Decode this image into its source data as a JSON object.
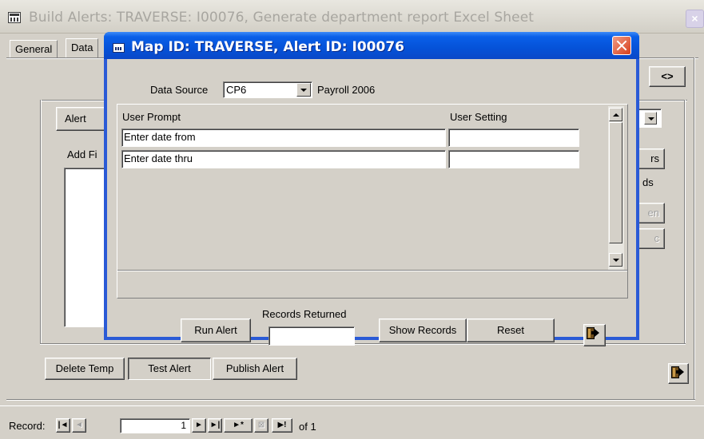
{
  "outer_window": {
    "title": "Build Alerts: TRAVERSE: I00076, Generate department report Excel Sheet",
    "close_label": "×",
    "tabs": [
      {
        "label": "General"
      },
      {
        "label": "Data"
      }
    ],
    "swap_button": "<>",
    "background_labels": {
      "alert_partial": "Alert",
      "add_fields_partial": "Add Fi",
      "rs_partial": "rs",
      "ds_partial": "ds",
      "en_partial": "en",
      "c_partial": "c"
    },
    "bottom_buttons": {
      "delete_temp": "Delete Temp",
      "test_alert": "Test Alert",
      "publish_alert": "Publish Alert"
    },
    "record_nav": {
      "label": "Record:",
      "current": "1",
      "first": "|◄",
      "prev": "◄",
      "next": "►",
      "last": "►|",
      "new": "►*",
      "of_label": "of 1"
    }
  },
  "dialog": {
    "title": "Map ID: TRAVERSE, Alert ID: I00076",
    "data_source": {
      "label": "Data Source",
      "value": "CP6",
      "description": "Payroll 2006"
    },
    "table": {
      "headers": {
        "prompt": "User Prompt",
        "setting": "User Setting"
      },
      "rows": [
        {
          "prompt": "Enter date from",
          "setting": ""
        },
        {
          "prompt": "Enter date thru",
          "setting": ""
        }
      ]
    },
    "run_alert": "Run Alert",
    "records_returned": {
      "label": "Records Returned",
      "value": ""
    },
    "show_records": "Show Records",
    "reset": "Reset"
  }
}
